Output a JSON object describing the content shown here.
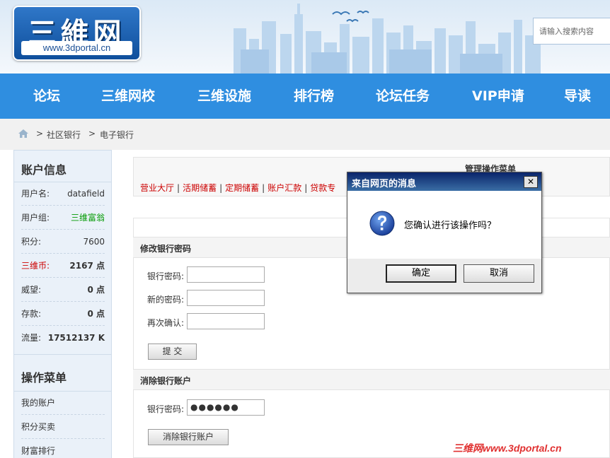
{
  "header": {
    "logo_title": "三維网",
    "logo_url": "www.3dportal.cn",
    "search_placeholder": "请输入搜索内容"
  },
  "nav": {
    "items": [
      "论坛",
      "三维网校",
      "三维设施",
      "排行榜",
      "论坛任务",
      "VIP申请",
      "导读"
    ]
  },
  "breadcrumb": {
    "home_icon": "home-icon",
    "separator": ">",
    "items": [
      "社区银行",
      "电子银行"
    ]
  },
  "sidebar": {
    "account_heading": "账户信息",
    "account_rows": [
      {
        "key": "用户名:",
        "value": "datafield"
      },
      {
        "key": "用户组:",
        "value": "三维富翁"
      },
      {
        "key": "积分:",
        "value": "7600"
      },
      {
        "key": "三维币:",
        "value": "2167 点"
      },
      {
        "key": "威望:",
        "value": "0 点"
      },
      {
        "key": "存款:",
        "value": "0 点"
      },
      {
        "key": "流量:",
        "value": "17512137 K"
      }
    ],
    "menu_heading": "操作菜单",
    "menu_items": [
      "我的账户",
      "积分买卖",
      "财富排行"
    ]
  },
  "main": {
    "ops_menu_title": "管理操作菜单",
    "links": [
      "营业大厅",
      "活期储蓄",
      "定期储蓄",
      "账户汇款",
      "贷款专"
    ],
    "change_password": {
      "title": "修改银行密码",
      "fields": [
        {
          "label": "银行密码:",
          "value": ""
        },
        {
          "label": "新的密码:",
          "value": ""
        },
        {
          "label": "再次确认:",
          "value": ""
        }
      ],
      "submit_label": "提 交"
    },
    "delete_account": {
      "title": "消除银行账户",
      "field_label": "银行密码:",
      "field_value": "●●●●●●",
      "button_label": "消除银行账户"
    }
  },
  "dialog": {
    "title": "来自网页的消息",
    "close_label": "✕",
    "message": "您确认进行该操作吗？",
    "icon": "question-icon",
    "ok_label": "确定",
    "cancel_label": "取消"
  },
  "watermark": "三维网www.3dportal.cn",
  "colors": {
    "nav_bg": "#2f8ee0",
    "link_red": "#cc0000",
    "sidebar_bg": "#eaf1f9",
    "dialog_title_bg": "#0a246a",
    "group_green": "#009900",
    "coin_red": "#cc0000"
  }
}
